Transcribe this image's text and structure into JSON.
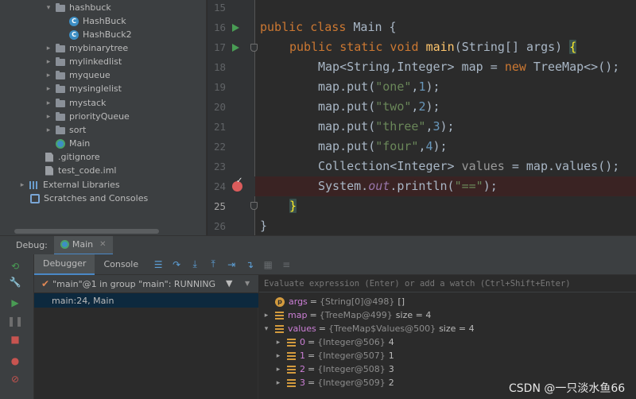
{
  "project_tree": {
    "items": [
      {
        "label": "hashbuck",
        "kind": "folder",
        "expanded": true
      },
      {
        "label": "HashBuck",
        "kind": "class"
      },
      {
        "label": "HashBuck2",
        "kind": "class"
      },
      {
        "label": "mybinarytree",
        "kind": "folder",
        "expanded": false
      },
      {
        "label": "mylinkedlist",
        "kind": "folder",
        "expanded": false
      },
      {
        "label": "myqueue",
        "kind": "folder",
        "expanded": false
      },
      {
        "label": "mysinglelist",
        "kind": "folder",
        "expanded": false
      },
      {
        "label": "mystack",
        "kind": "folder",
        "expanded": false
      },
      {
        "label": "priorityQueue",
        "kind": "folder",
        "expanded": false
      },
      {
        "label": "sort",
        "kind": "folder",
        "expanded": false
      },
      {
        "label": "Main",
        "kind": "main-class"
      },
      {
        "label": ".gitignore",
        "kind": "file"
      },
      {
        "label": "test_code.iml",
        "kind": "file"
      },
      {
        "label": "External Libraries",
        "kind": "library",
        "expanded": false
      },
      {
        "label": "Scratches and Consoles",
        "kind": "scratch"
      }
    ]
  },
  "editor": {
    "lines": [
      {
        "no": "15"
      },
      {
        "no": "16"
      },
      {
        "no": "17"
      },
      {
        "no": "18"
      },
      {
        "no": "19"
      },
      {
        "no": "20"
      },
      {
        "no": "21"
      },
      {
        "no": "22"
      },
      {
        "no": "23"
      },
      {
        "no": "24"
      },
      {
        "no": "25"
      },
      {
        "no": "26"
      }
    ],
    "code": {
      "l16": {
        "kw1": "public class",
        "rest": " Main {"
      },
      "l17": {
        "kw": "public static void",
        "fn": "main",
        "args": "(String[] args) ",
        "brace": "{"
      },
      "l18": {
        "a": "Map<String,Integer> map = ",
        "kw": "new",
        "b": " TreeMap<>();"
      },
      "l19": {
        "a": "map.put(",
        "s": "\"one\"",
        "c": ",",
        "n": "1",
        "e": ");"
      },
      "l20": {
        "a": "map.put(",
        "s": "\"two\"",
        "c": ",",
        "n": "2",
        "e": ");"
      },
      "l21": {
        "a": "map.put(",
        "s": "\"three\"",
        "c": ",",
        "n": "3",
        "e": ");"
      },
      "l22": {
        "a": "map.put(",
        "s": "\"four\"",
        "c": ",",
        "n": "4",
        "e": ");"
      },
      "l23": {
        "a": "Collection<Integer> ",
        "u": "values",
        "b": " = map.values();"
      },
      "l24": {
        "a": "System.",
        "it": "out",
        "b": ".println(",
        "s": "\"==\"",
        "e": ");"
      },
      "l25": {
        "brace": "}"
      },
      "l26": {
        "brace": "}"
      }
    },
    "colors": {
      "keyword": "#cc7832",
      "string": "#6a8759",
      "number": "#6897bb",
      "function": "#ffc66d",
      "breakpoint_line": "#3a2323"
    }
  },
  "debug": {
    "label": "Debug:",
    "tab_label": "Main",
    "tabs": [
      "Debugger",
      "Console"
    ],
    "thread_label": "\"main\"@1 in group \"main\": RUNNING",
    "frame_label": "main:24, Main",
    "eval_placeholder": "Evaluate expression (Enter) or add a watch (Ctrl+Shift+Enter)",
    "variables": [
      {
        "name": "args",
        "type": "{String[0]@498}",
        "value": "[]",
        "icon": "p",
        "expanded": null
      },
      {
        "name": "map",
        "type": "{TreeMap@499}",
        "value": "size = 4",
        "icon": "f",
        "expanded": false
      },
      {
        "name": "values",
        "type": "{TreeMap$Values@500}",
        "value": "size = 4",
        "icon": "f",
        "expanded": true
      },
      {
        "name": "0",
        "type": "{Integer@506}",
        "value": "4",
        "icon": "f",
        "expanded": false
      },
      {
        "name": "1",
        "type": "{Integer@507}",
        "value": "1",
        "icon": "f",
        "expanded": false
      },
      {
        "name": "2",
        "type": "{Integer@508}",
        "value": "3",
        "icon": "f",
        "expanded": false
      },
      {
        "name": "3",
        "type": "{Integer@509}",
        "value": "2",
        "icon": "f",
        "expanded": false
      }
    ]
  },
  "watermark": "CSDN @一只淡水鱼66"
}
